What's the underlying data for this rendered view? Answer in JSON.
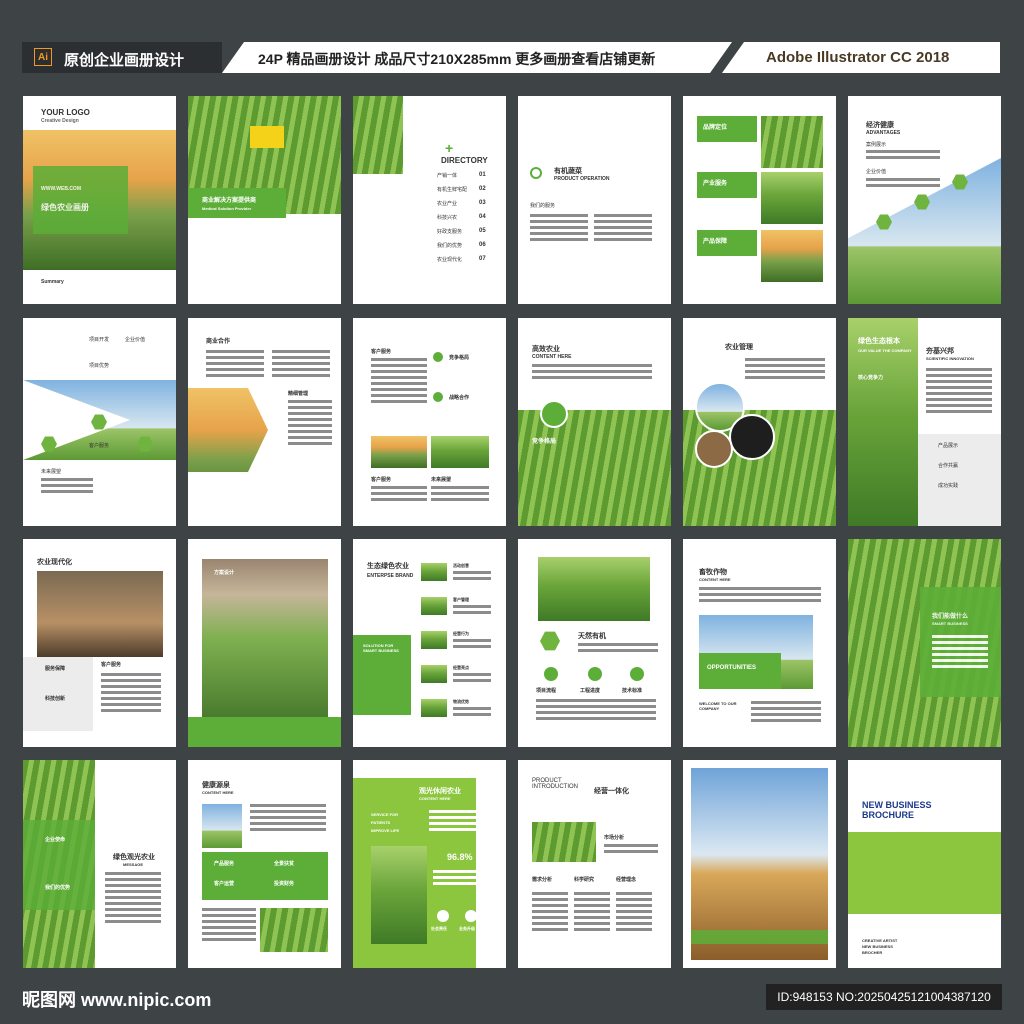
{
  "header": {
    "ai_badge": "Ai",
    "left_title": "原创企业画册设计",
    "middle_text": "24P 精品画册设计 成品尺寸210X285mm 更多画册查看店铺更新",
    "right_text": "Adobe Illustrator CC 2018"
  },
  "pages": {
    "p1": {
      "logo": "YOUR LOGO",
      "logo_sub": "Creative Design",
      "web": "WWW.WEB.COM",
      "title": "绿色农业画册",
      "summary": "Summary"
    },
    "p2": {
      "label": "商业解决方案提供商",
      "sub": "Medical Solution Provider"
    },
    "p3": {
      "title": "DIRECTORY",
      "items": [
        "产销一体",
        "有机生鲜宅配",
        "农业产业",
        "科技兴农",
        "好政支服务",
        "我们的优势",
        "农业现代化"
      ],
      "nums": [
        "01",
        "02",
        "03",
        "04",
        "05",
        "06",
        "07"
      ]
    },
    "p4": {
      "title": "有机蔬菜",
      "sub": "PRODUCT OPERATION",
      "services": "我们的服务"
    },
    "p5": {
      "labels": [
        "品牌定位",
        "产业服务",
        "产品保障"
      ]
    },
    "p6": {
      "title": "经济健康",
      "sub": "ADVANTAGES",
      "items": [
        "案例展示",
        "企业价值"
      ]
    },
    "p7": {
      "items": [
        "项目开发",
        "企业价值",
        "项目优势",
        "客户服务",
        "未来展望"
      ]
    },
    "p8": {
      "title": "商业合作",
      "sub2": "精细管理"
    },
    "p9": {
      "title": "客户服务",
      "items": [
        "竞争格局",
        "战略合作",
        "客户服务",
        "未来展望"
      ]
    },
    "p10": {
      "title": "高效农业",
      "sub": "CONTENT HERE",
      "caption": "竞争格局"
    },
    "p11": {
      "title": "农业管理"
    },
    "p12": {
      "title": "绿色生态根本",
      "sub": "OUR VALUE THE COMPANY",
      "right_title": "夯基兴邦",
      "right_sub": "SCIENTIFIC INNOVATION",
      "caption": "核心竞争力",
      "items": [
        "产品展示",
        "合作共赢",
        "成功实践"
      ]
    },
    "p13": {
      "title": "农业现代化",
      "items": [
        "服务保障",
        "科技创新"
      ],
      "right": "客户服务"
    },
    "p14": {
      "label": "方案设计"
    },
    "p15": {
      "title": "生态绿色农业",
      "sub": "ENTERPSE BRAND",
      "box": "SOLUTION FOR SMART BUSINESS",
      "items": [
        "活动创意",
        "客户管理",
        "经营行为",
        "经营亮点",
        "物流优势"
      ]
    },
    "p16": {
      "title": "天然有机",
      "items": [
        "项目流程",
        "工程进度",
        "技术标准"
      ]
    },
    "p17": {
      "title": "畜牧作物",
      "sub": "CONTENT HERE",
      "opp": "OPPORTUNITIES",
      "welcome": "WELCOME TO OUR COMPANY"
    },
    "p18": {
      "label": "我们能做什么",
      "sub": "SMART BUSINESS"
    },
    "p19": {
      "items": [
        "企业使命",
        "我们的优势"
      ],
      "title": "绿色观光农业",
      "sub": "MESSAGE"
    },
    "p20": {
      "title": "健康源泉",
      "sub": "CONTENT HERE",
      "items": [
        "产品服务",
        "全景扶贫",
        "客户运营",
        "投资财务"
      ]
    },
    "p21": {
      "title": "观光休闲农业",
      "sub": "CONTENT HERE",
      "list": [
        "SERVICE FOR",
        "PATIENTS",
        "IMPROVE LIFE"
      ],
      "percent": "96.8%",
      "icons": [
        "社会责任",
        "业务升级"
      ]
    },
    "p22": {
      "title": "PRODUCT INTRODUCTION",
      "title2": "经营一体化",
      "items": [
        "市场分析",
        "需求分析",
        "科学研究",
        "经营理念"
      ]
    },
    "p24": {
      "title1": "NEW  BUSINESS",
      "title2": "BROCHURE",
      "lines": [
        "CREATIVE ARTIST",
        "NEW BUSINESS",
        "BROCHER"
      ]
    }
  },
  "footer": {
    "logo": "昵图网 www.nipic.com",
    "id": "ID:948153 NO:20250425121004387120"
  }
}
